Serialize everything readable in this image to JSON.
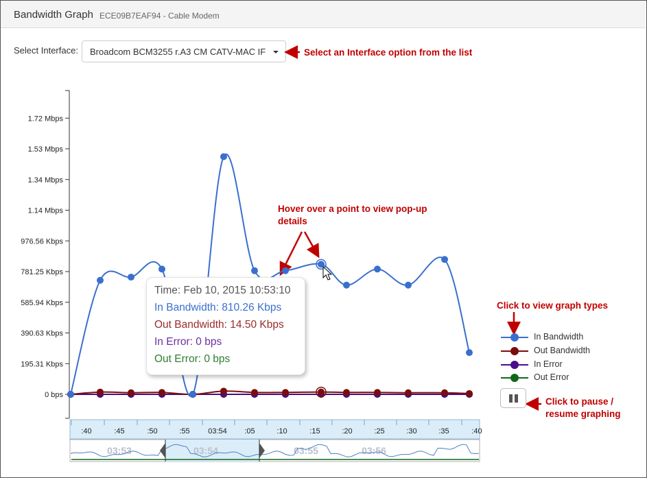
{
  "header": {
    "title": "Bandwidth Graph",
    "subtitle": "ECE09B7EAF94 - Cable Modem"
  },
  "interface": {
    "label": "Select Interface:",
    "selected": "Broadcom BCM3255 r.A3 CM CATV-MAC IF"
  },
  "callouts": {
    "select": "Select an Interface option from the list",
    "hover": "Hover over a point to view pop-up details",
    "graph_types": "Click to view graph types",
    "pause": "Click to pause / resume graphing"
  },
  "tooltip": {
    "time": "Time: Feb 10, 2015 10:53:10",
    "in_bandwidth": "In Bandwidth: 810.26 Kbps",
    "out_bandwidth": "Out Bandwidth: 14.50 Kbps",
    "in_error": "In Error: 0 bps",
    "out_error": "Out Error: 0 bps"
  },
  "legend": [
    {
      "label": "In Bandwidth",
      "color": "#3a6fce"
    },
    {
      "label": "Out Bandwidth",
      "color": "#7b0c0c"
    },
    {
      "label": "In Error",
      "color": "#4b0d8a"
    },
    {
      "label": "Out Error",
      "color": "#11661a"
    }
  ],
  "colors": {
    "accent_callout": "#c00000",
    "navigator_fill": "#dbedf9"
  },
  "icons": {
    "pause": "pause-icon",
    "arrow": "red-arrow-icon",
    "cursor": "mouse-pointer-icon"
  },
  "chart_data": {
    "type": "line",
    "ylabels": [
      "0 bps",
      "195.31 Kbps",
      "390.63 Kbps",
      "585.94 Kbps",
      "781.25 Kbps",
      "976.56 Kbps",
      "1.14 Mbps",
      "1.34 Mbps",
      "1.53 Mbps",
      "1.72 Mbps"
    ],
    "ylim": [
      0,
      1.76
    ],
    "yunit": "Mbps",
    "xlabels": [
      ":40",
      ":45",
      ":50",
      ":55",
      "03:54",
      ":05",
      ":10",
      ":15",
      ":20",
      ":25",
      ":30",
      ":35",
      ":40"
    ],
    "navigator_labels": [
      "03:53",
      "03:54",
      "03:55",
      "03:56"
    ],
    "series": [
      {
        "name": "In Bandwidth",
        "color": "#3a6fce",
        "values": [
          0,
          0.71,
          0.73,
          0.78,
          0,
          1.48,
          0.77,
          0.77,
          0.81,
          0.68,
          0.78,
          0.68,
          0.84,
          0.26
        ]
      },
      {
        "name": "Out Bandwidth",
        "color": "#7b0c0c",
        "values": [
          0,
          0.014,
          0.01,
          0.012,
          0,
          0.02,
          0.012,
          0.012,
          0.0145,
          0.012,
          0.012,
          0.01,
          0.01,
          0.005
        ]
      },
      {
        "name": "In Error",
        "color": "#4b0d8a",
        "values": [
          0,
          0,
          0,
          0,
          0,
          0,
          0,
          0,
          0,
          0,
          0,
          0,
          0,
          0
        ]
      },
      {
        "name": "Out Error",
        "color": "#11661a",
        "values": [
          0,
          0,
          0,
          0,
          0,
          0,
          0,
          0,
          0,
          0,
          0,
          0,
          0,
          0
        ]
      }
    ]
  }
}
